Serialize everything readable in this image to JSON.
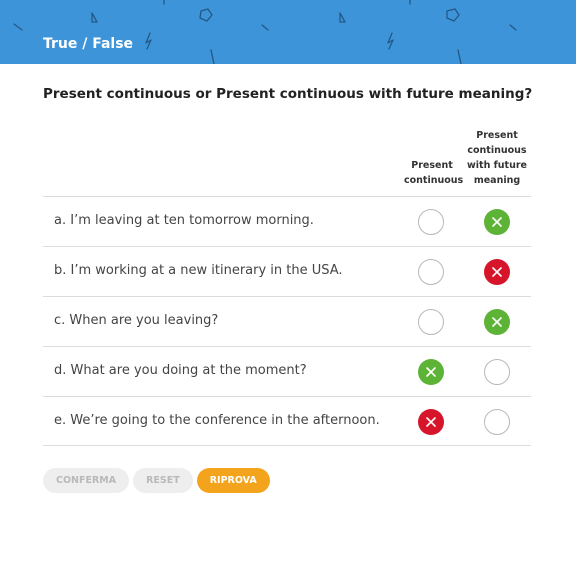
{
  "header": {
    "title": "True / False",
    "background": "#3d94d9"
  },
  "question": "Present continuous or Present continuous with future meaning?",
  "columns": [
    {
      "label": "Present continuous"
    },
    {
      "label": "Present continuous with future meaning"
    }
  ],
  "rows": [
    {
      "text": "a. I’m leaving at ten tomorrow morning.",
      "col1": "empty",
      "col2": "correct"
    },
    {
      "text": "b. I’m working at a new itinerary in the USA.",
      "col1": "empty",
      "col2": "wrong"
    },
    {
      "text": "c. When are you leaving?",
      "col1": "empty",
      "col2": "correct"
    },
    {
      "text": "d. What are you doing at the moment?",
      "col1": "correct",
      "col2": "empty"
    },
    {
      "text": "e. We’re going to the conference in the afternoon.",
      "col1": "wrong",
      "col2": "empty"
    }
  ],
  "buttons": {
    "confirm": "CONFERMA",
    "reset": "RESET",
    "retry": "RIPROVA"
  },
  "colors": {
    "correct": "#5cb336",
    "wrong": "#d7152a",
    "retry": "#f4a31c"
  }
}
